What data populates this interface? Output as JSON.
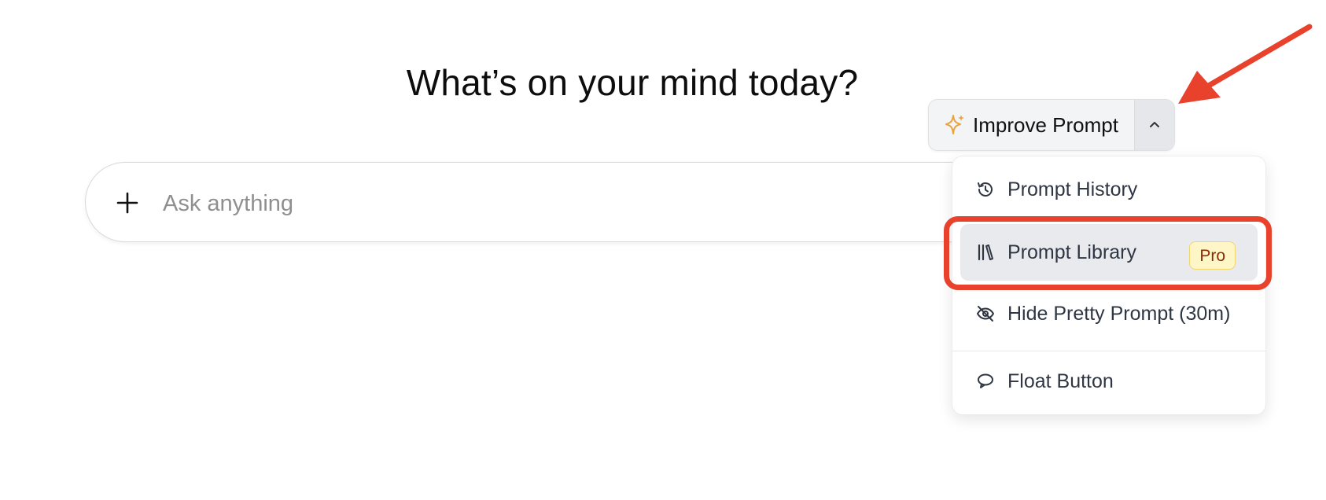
{
  "headline": "What’s on your mind today?",
  "prompt": {
    "placeholder": "Ask anything",
    "value": ""
  },
  "improve_button": {
    "label": "Improve Prompt",
    "icon": "sparkles-icon",
    "icon_color": "#e8a33c"
  },
  "menu": {
    "items": [
      {
        "label": "Prompt History",
        "icon": "history-icon"
      },
      {
        "label": "Prompt Library",
        "icon": "library-icon",
        "badge": "Pro",
        "highlighted": true
      },
      {
        "label": "Hide Pretty Prompt (30m)",
        "icon": "eye-off-icon"
      },
      {
        "label": "Float Button",
        "icon": "chat-bubble-icon"
      }
    ]
  },
  "annotation": {
    "color": "#e8412c"
  }
}
